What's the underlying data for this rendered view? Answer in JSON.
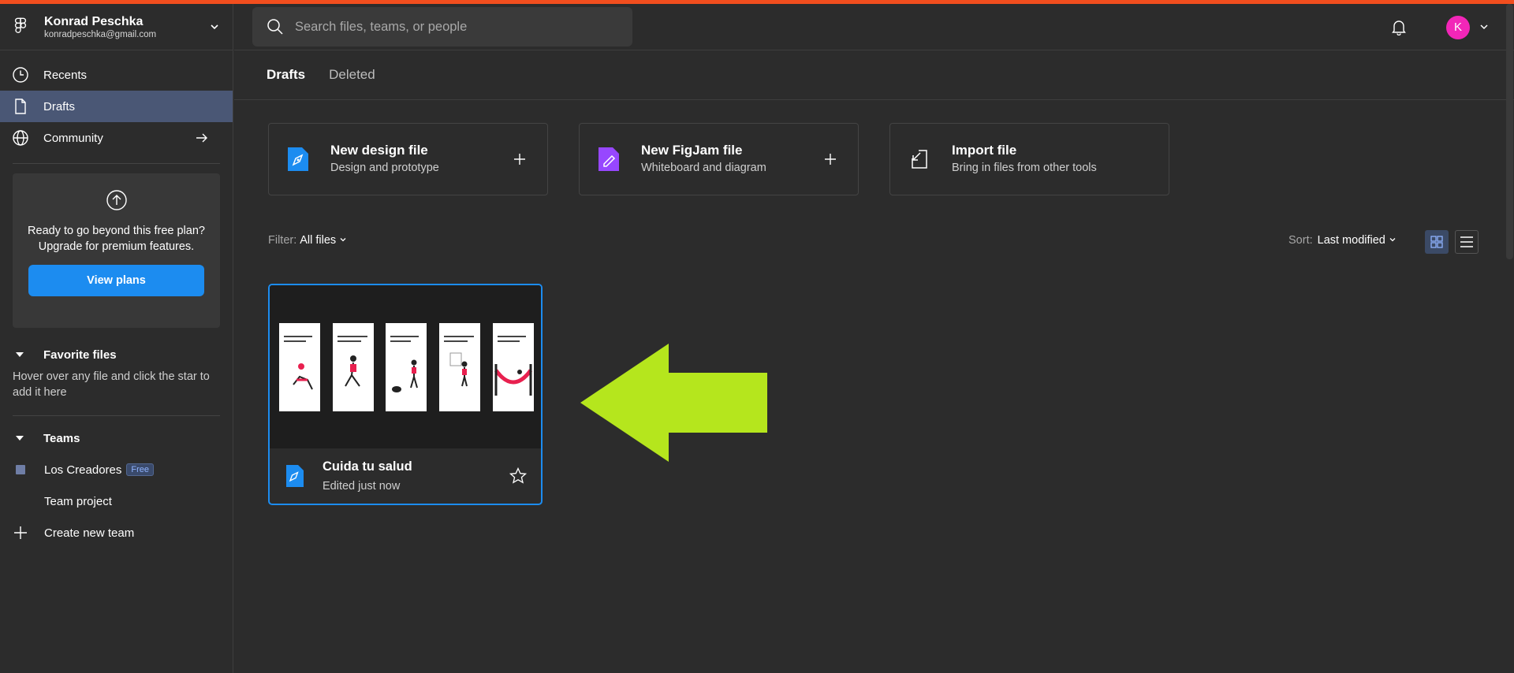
{
  "account": {
    "name": "Konrad Peschka",
    "email": "konradpeschka@gmail.com"
  },
  "nav": [
    {
      "label": "Recents",
      "icon": "clock-icon"
    },
    {
      "label": "Drafts",
      "icon": "file-icon",
      "active": true
    },
    {
      "label": "Community",
      "icon": "globe-icon"
    }
  ],
  "upgrade": {
    "text": "Ready to go beyond this free plan? Upgrade for premium features.",
    "button": "View plans"
  },
  "favorites": {
    "title": "Favorite files",
    "hint": "Hover over any file and click the star to add it here"
  },
  "teams": {
    "title": "Teams",
    "items": [
      {
        "label": "Los Creadores",
        "badge": "Free"
      },
      {
        "label": "Team project"
      },
      {
        "label": "Create new team"
      }
    ]
  },
  "search": {
    "placeholder": "Search files, teams, or people"
  },
  "avatar": {
    "initial": "K",
    "color": "#f226b8"
  },
  "tabs": [
    {
      "label": "Drafts",
      "active": true
    },
    {
      "label": "Deleted"
    }
  ],
  "create": [
    {
      "title": "New design file",
      "subtitle": "Design and prototype",
      "icon": "design-file-icon"
    },
    {
      "title": "New FigJam file",
      "subtitle": "Whiteboard and diagram",
      "icon": "figjam-file-icon"
    },
    {
      "title": "Import file",
      "subtitle": "Bring in files from other tools",
      "icon": "import-icon"
    }
  ],
  "filter": {
    "label": "Filter:",
    "value": "All files"
  },
  "sort": {
    "label": "Sort:",
    "value": "Last modified"
  },
  "file": {
    "name": "Cuida tu salud",
    "edited": "Edited just now"
  },
  "colors": {
    "accent": "#1c8cf0",
    "brand": "#f24e1e",
    "arrow": "#b5e61d",
    "active_nav": "#4a5775"
  }
}
